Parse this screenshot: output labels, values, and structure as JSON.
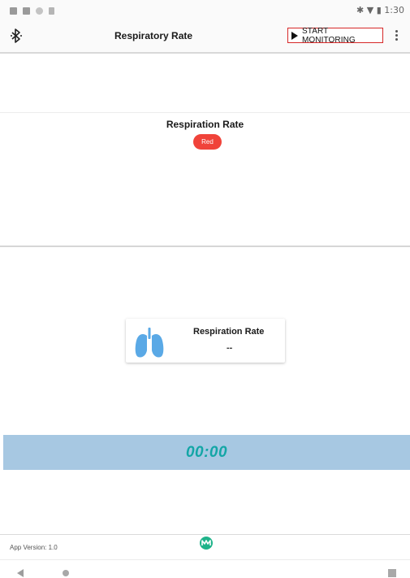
{
  "status_bar": {
    "time": "1:30",
    "left_icons": [
      "notification-icon",
      "image-icon",
      "circle-icon",
      "sd-card-icon"
    ],
    "right_icons": [
      "bluetooth-icon",
      "wifi-icon",
      "battery-icon"
    ]
  },
  "app_bar": {
    "title": "Respiratory Rate",
    "start_button_label": "START MONITORING",
    "left_icon": "bluetooth-icon",
    "menu_icon": "more-vert-icon"
  },
  "rate_section": {
    "heading": "Respiration Rate",
    "status_badge": "Red",
    "badge_color": "#f0433a"
  },
  "rate_card": {
    "title": "Respiration Rate",
    "value": "--",
    "icon": "lungs-icon",
    "icon_color": "#5aa9e6"
  },
  "timer": {
    "value": "00:00",
    "band_color": "#a7c8e2",
    "text_color": "#13a6a6"
  },
  "footer": {
    "app_version": "App Version: 1.0",
    "logo_icon": "maxim-logo-icon",
    "logo_color": "#1fb38a"
  },
  "nav_bar": {
    "icons": [
      "back-icon",
      "home-icon",
      "recents-icon"
    ]
  }
}
